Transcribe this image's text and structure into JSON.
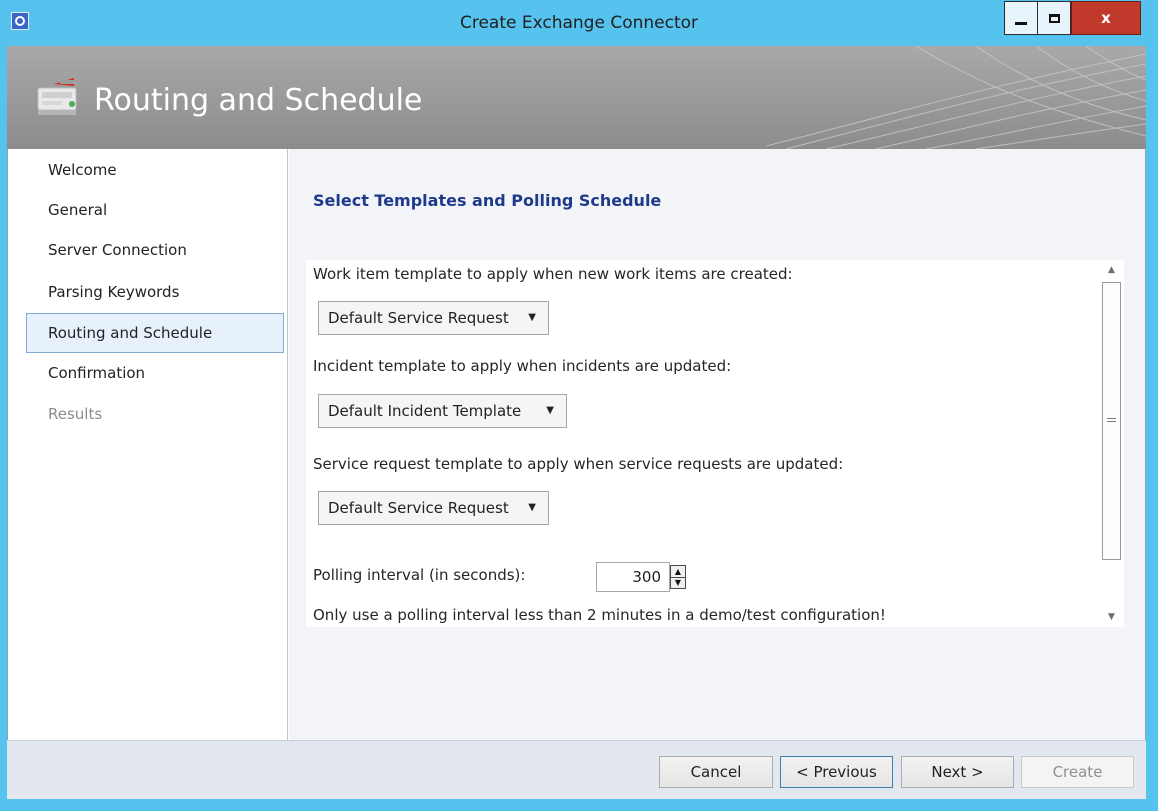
{
  "window": {
    "title": "Create Exchange Connector",
    "close_label": "x",
    "colors": {
      "frame": "#56c2ee",
      "heading": "#1f3a8a",
      "close": "#c0392b"
    }
  },
  "header": {
    "title": "Routing and Schedule",
    "icon": "connector-wizard-icon"
  },
  "nav": {
    "items": [
      {
        "label": "Welcome"
      },
      {
        "label": "General"
      },
      {
        "label": "Server Connection"
      },
      {
        "label": "Parsing Keywords"
      },
      {
        "label": "Routing and Schedule",
        "selected": true
      },
      {
        "label": "Confirmation"
      },
      {
        "label": "Results",
        "disabled": true
      }
    ]
  },
  "main": {
    "heading": "Select Templates and Polling Schedule",
    "work_item_label": "Work item template to apply when new work items are created:",
    "work_item_value": "Default Service Request",
    "incident_label": "Incident template to apply when incidents are updated:",
    "incident_value": "Default Incident Template",
    "service_request_label": "Service request template to apply when service requests are updated:",
    "service_request_value": "Default Service Request",
    "polling_label": "Polling interval (in seconds):",
    "polling_value": "300",
    "polling_note": "Only use a polling interval less than 2 minutes in a demo/test configuration!"
  },
  "footer": {
    "cancel": "Cancel",
    "previous": "< Previous",
    "next": "Next >",
    "create": "Create"
  }
}
